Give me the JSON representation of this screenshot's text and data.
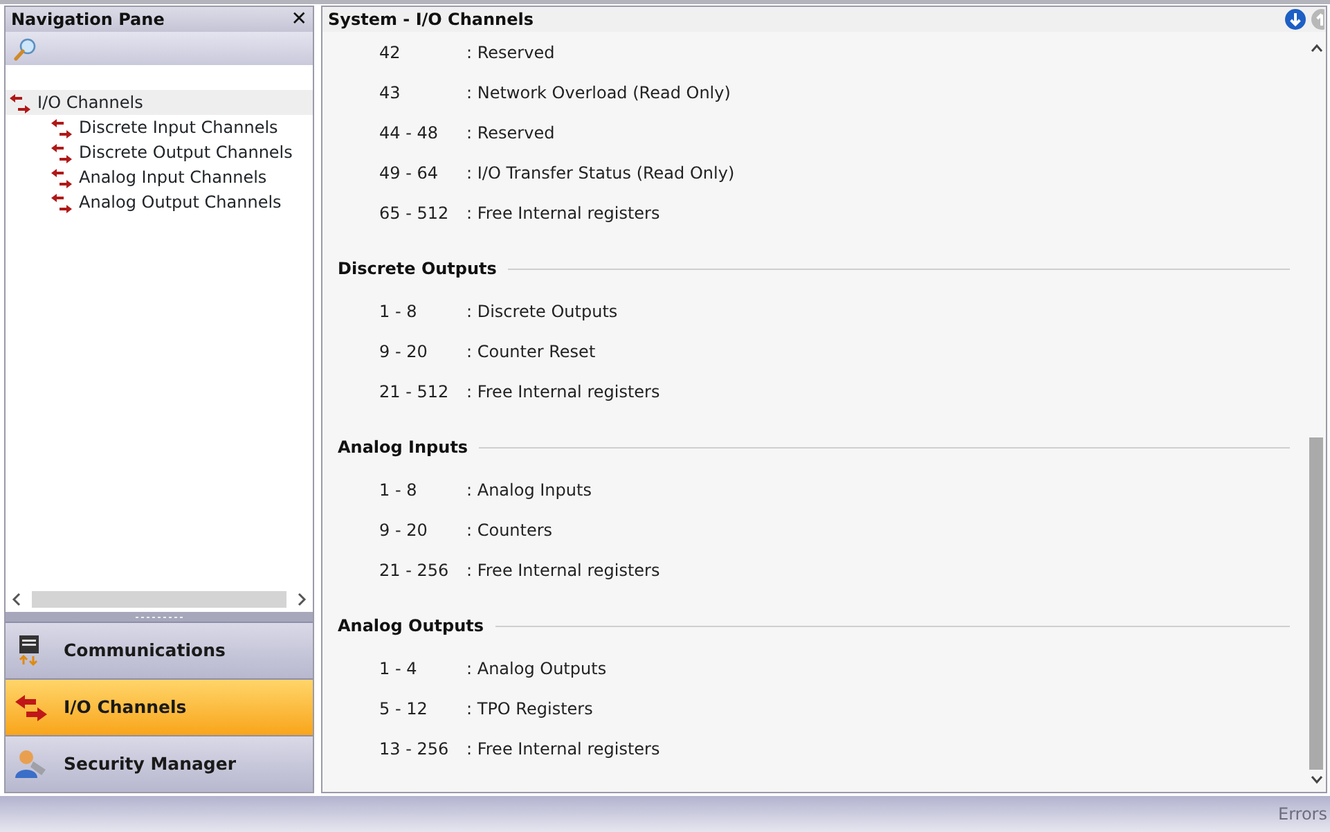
{
  "navigation_pane": {
    "title": "Navigation Pane",
    "close": "✕",
    "tree": [
      {
        "label": "I/O Channels",
        "selected": true,
        "children": [
          {
            "label": "Discrete Input Channels",
            "selected": false
          },
          {
            "label": "Discrete Output Channels",
            "selected": false
          },
          {
            "label": "Analog Input Channels",
            "selected": false
          },
          {
            "label": "Analog Output Channels",
            "selected": false
          }
        ]
      }
    ],
    "buttons": [
      {
        "label": "Communications",
        "kind": "communications",
        "selected": false
      },
      {
        "label": "I/O Channels",
        "kind": "io",
        "selected": true
      },
      {
        "label": "Security Manager",
        "kind": "security",
        "selected": false
      }
    ]
  },
  "main": {
    "title": "System - I/O Channels",
    "down_enabled": true,
    "up_enabled": false,
    "sections": [
      {
        "rows": [
          {
            "range": "42",
            "desc": ": Reserved"
          },
          {
            "range": "43",
            "desc": ": Network Overload (Read Only)"
          },
          {
            "range": "44 - 48",
            "desc": ": Reserved"
          },
          {
            "range": "49 - 64",
            "desc": ": I/O Transfer Status (Read Only)"
          },
          {
            "range": "65 - 512",
            "desc": ": Free Internal registers"
          }
        ]
      },
      {
        "title": "Discrete Outputs",
        "rows": [
          {
            "range": "1 - 8",
            "desc": ": Discrete Outputs"
          },
          {
            "range": "9 - 20",
            "desc": ": Counter Reset"
          },
          {
            "range": "21 - 512",
            "desc": ": Free Internal registers"
          }
        ]
      },
      {
        "title": "Analog Inputs",
        "rows": [
          {
            "range": "1 - 8",
            "desc": ": Analog Inputs"
          },
          {
            "range": "9 - 20",
            "desc": ": Counters"
          },
          {
            "range": "21 - 256",
            "desc": ": Free Internal registers"
          }
        ]
      },
      {
        "title": "Analog Outputs",
        "rows": [
          {
            "range": "1 - 4",
            "desc": ": Analog Outputs"
          },
          {
            "range": "5 - 12",
            "desc": ": TPO Registers"
          },
          {
            "range": "13 - 256",
            "desc": ": Free Internal registers"
          }
        ]
      }
    ]
  },
  "status_bar": {
    "errors": "Errors",
    "errors_enabled": false
  }
}
